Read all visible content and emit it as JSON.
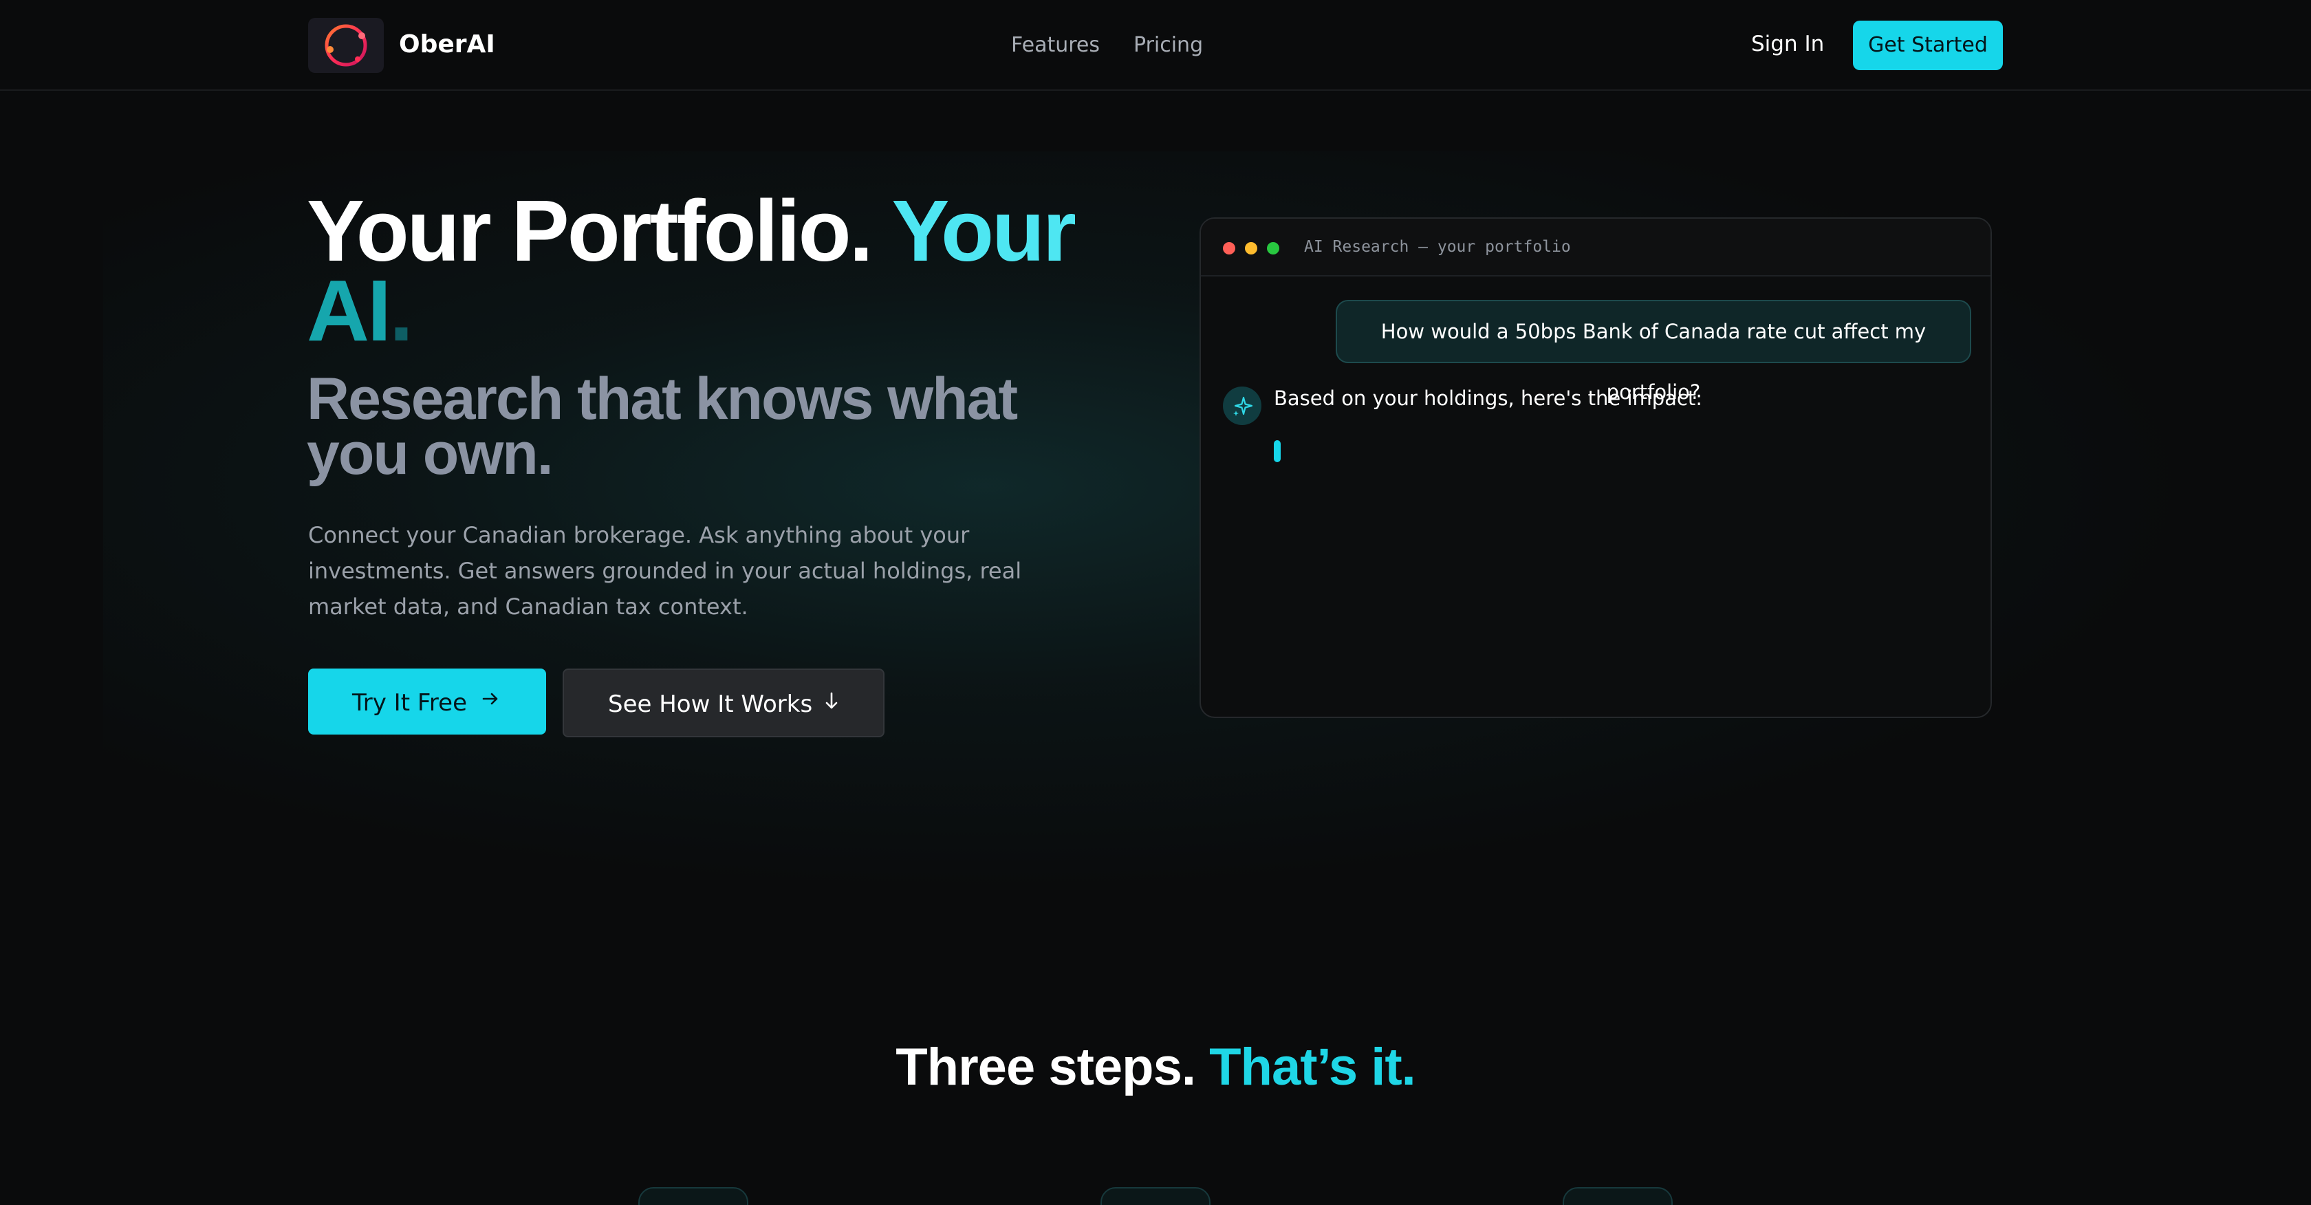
{
  "nav": {
    "brand": "OberAI",
    "links": [
      "Features",
      "Pricing"
    ],
    "sign_in": "Sign In",
    "get_started": "Get Started"
  },
  "hero": {
    "headline_part1": "Your Portfolio.",
    "headline_part2": "Your",
    "headline_part3": "AI",
    "headline_part4": ".",
    "subheadline": "Research that knows what you own.",
    "description": "Connect your Canadian brokerage. Ask anything about your investments. Get answers grounded in your actual holdings, real market data, and Canadian tax context.",
    "cta_primary": "Try It Free",
    "cta_secondary": "See How It Works",
    "cta_primary_icon": "arrow-right-icon",
    "cta_secondary_icon": "arrow-down-icon"
  },
  "chat": {
    "title": "AI Research — your portfolio",
    "user_message": "How would a 50bps Bank of Canada rate cut affect my portfolio?",
    "ai_message": "Based on your holdings, here's the impact:",
    "ai_icon": "sparkle-icon",
    "window_dot_colors": [
      "#ff5f57",
      "#febc2e",
      "#28c840"
    ]
  },
  "steps": {
    "title_part1": "Three steps.",
    "title_part2": "That’s it."
  },
  "colors": {
    "accent": "#16d6ea",
    "background": "#0a0b0c"
  }
}
